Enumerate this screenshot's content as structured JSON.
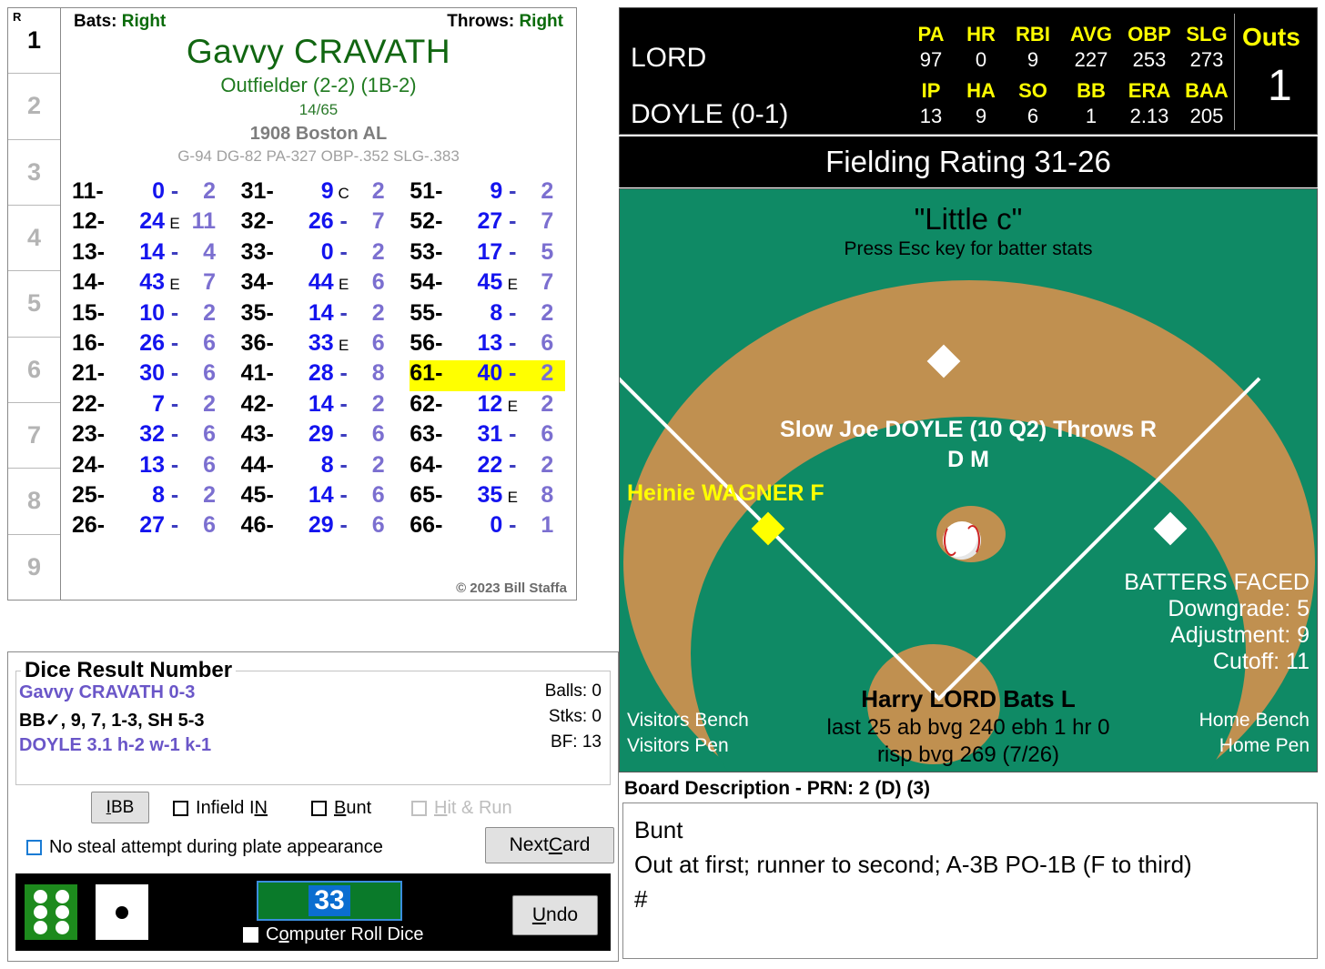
{
  "player_card": {
    "inning_header": "R",
    "innings": [
      "1",
      "2",
      "3",
      "4",
      "5",
      "6",
      "7",
      "8",
      "9"
    ],
    "active_inning": "1",
    "bats_label": "Bats:",
    "bats_value": "Right",
    "throws_label": "Throws:",
    "throws_value": "Right",
    "name": "Gavvy CRAVATH",
    "position": "Outfielder (2-2) (1B-2)",
    "card_number": "14/65",
    "team": "1908 Boston AL",
    "stats": "G-94 DG-82 PA-327 OBP-.352 SLG-.383",
    "copyright": "© 2023 Bill Staffa",
    "highlight_key": "61-",
    "columns": [
      [
        {
          "key": "11-",
          "value": "0",
          "sep": "-",
          "trail": "2"
        },
        {
          "key": "12-",
          "value": "24",
          "sep": "E",
          "trail": "11"
        },
        {
          "key": "13-",
          "value": "14",
          "sep": "-",
          "trail": "4"
        },
        {
          "key": "14-",
          "value": "43",
          "sep": "E",
          "trail": "7"
        },
        {
          "key": "15-",
          "value": "10",
          "sep": "-",
          "trail": "2"
        },
        {
          "key": "16-",
          "value": "26",
          "sep": "-",
          "trail": "6"
        },
        {
          "key": "21-",
          "value": "30",
          "sep": "-",
          "trail": "6"
        },
        {
          "key": "22-",
          "value": "7",
          "sep": "-",
          "trail": "2"
        },
        {
          "key": "23-",
          "value": "32",
          "sep": "-",
          "trail": "6"
        },
        {
          "key": "24-",
          "value": "13",
          "sep": "-",
          "trail": "6"
        },
        {
          "key": "25-",
          "value": "8",
          "sep": "-",
          "trail": "2"
        },
        {
          "key": "26-",
          "value": "27",
          "sep": "-",
          "trail": "6"
        }
      ],
      [
        {
          "key": "31-",
          "value": "9",
          "sep": "C",
          "trail": "2"
        },
        {
          "key": "32-",
          "value": "26",
          "sep": "-",
          "trail": "7"
        },
        {
          "key": "33-",
          "value": "0",
          "sep": "-",
          "trail": "2"
        },
        {
          "key": "34-",
          "value": "44",
          "sep": "E",
          "trail": "6"
        },
        {
          "key": "35-",
          "value": "14",
          "sep": "-",
          "trail": "2"
        },
        {
          "key": "36-",
          "value": "33",
          "sep": "E",
          "trail": "6"
        },
        {
          "key": "41-",
          "value": "28",
          "sep": "-",
          "trail": "8"
        },
        {
          "key": "42-",
          "value": "14",
          "sep": "-",
          "trail": "2"
        },
        {
          "key": "43-",
          "value": "29",
          "sep": "-",
          "trail": "6"
        },
        {
          "key": "44-",
          "value": "8",
          "sep": "-",
          "trail": "2"
        },
        {
          "key": "45-",
          "value": "14",
          "sep": "-",
          "trail": "6"
        },
        {
          "key": "46-",
          "value": "29",
          "sep": "-",
          "trail": "6"
        }
      ],
      [
        {
          "key": "51-",
          "value": "9",
          "sep": "-",
          "trail": "2"
        },
        {
          "key": "52-",
          "value": "27",
          "sep": "-",
          "trail": "7"
        },
        {
          "key": "53-",
          "value": "17",
          "sep": "-",
          "trail": "5"
        },
        {
          "key": "54-",
          "value": "45",
          "sep": "E",
          "trail": "7"
        },
        {
          "key": "55-",
          "value": "8",
          "sep": "-",
          "trail": "2"
        },
        {
          "key": "56-",
          "value": "13",
          "sep": "-",
          "trail": "6"
        },
        {
          "key": "61-",
          "value": "40",
          "sep": "-",
          "trail": "2"
        },
        {
          "key": "62-",
          "value": "12",
          "sep": "E",
          "trail": "2"
        },
        {
          "key": "63-",
          "value": "31",
          "sep": "-",
          "trail": "6"
        },
        {
          "key": "64-",
          "value": "22",
          "sep": "-",
          "trail": "2"
        },
        {
          "key": "65-",
          "value": "35",
          "sep": "E",
          "trail": "8"
        },
        {
          "key": "66-",
          "value": "0",
          "sep": "-",
          "trail": "1"
        }
      ]
    ]
  },
  "scoreboard": {
    "batter_name": "LORD",
    "batter_headers": [
      "PA",
      "HR",
      "RBI",
      "AVG",
      "OBP",
      "SLG"
    ],
    "batter_values": [
      "97",
      "0",
      "9",
      "227",
      "253",
      "273"
    ],
    "pitcher_name": "DOYLE (0-1)",
    "pitcher_headers": [
      "IP",
      "HA",
      "SO",
      "BB",
      "ERA",
      "BAA"
    ],
    "pitcher_values": [
      "13",
      "9",
      "6",
      "1",
      "2.13",
      "205"
    ],
    "outs_label": "Outs",
    "outs_value": "1",
    "fielding_rating": "Fielding Rating 31-26"
  },
  "field": {
    "nickname": "\"Little c\"",
    "esc_hint": "Press Esc key for batter stats",
    "pitcher_line": "Slow Joe DOYLE (10 Q2) Throws R",
    "pitcher_sub": "D M",
    "runner_first": "Heinie WAGNER F",
    "batters_faced_title": "BATTERS FACED",
    "downgrade": "Downgrade: 5",
    "adjustment": "Adjustment: 9",
    "cutoff": "Cutoff: 11",
    "batter_name": "Harry LORD Bats L",
    "batter_line1": "last 25 ab bvg 240 ebh 1 hr 0",
    "batter_line2": "risp bvg 269 (7/26)",
    "visitors_bench": "Visitors Bench",
    "visitors_pen": "Visitors Pen",
    "home_bench": "Home Bench",
    "home_pen": "Home Pen"
  },
  "dice_panel": {
    "legend": "Dice Result Number",
    "line1": "Gavvy CRAVATH  0-3",
    "line2": "BB✓, 9, 7, 1-3, SH 5-3",
    "line3": "DOYLE 3.1  h-2  w-1  k-1",
    "balls": "Balls: 0",
    "strikes": "Stks: 0",
    "bf": "BF: 13",
    "ibb_label": "IBB",
    "infield_in_label": "Infield IN",
    "bunt_label": "Bunt",
    "hit_run_label": "Hit & Run",
    "no_steal_label": "No steal attempt during plate appearance",
    "next_card_label": "Next Card",
    "undo_label": "Undo",
    "computer_roll_label": "Computer Roll Dice",
    "roll_value": "33",
    "green_die_pips": 6,
    "white_die_pips": 1
  },
  "board": {
    "title": "Board Description - PRN: 2 (D) (3)",
    "lines": [
      "Bunt",
      "Out at first; runner to second; A-3B PO-1B (F to third)",
      "#"
    ]
  },
  "colors": {
    "field_green": "#0f8a65",
    "dirt": "#c09050",
    "highlight": "#ffff00",
    "accent_blue": "#1414ee",
    "purple": "#7b6fd0",
    "card_green": "#116611"
  }
}
